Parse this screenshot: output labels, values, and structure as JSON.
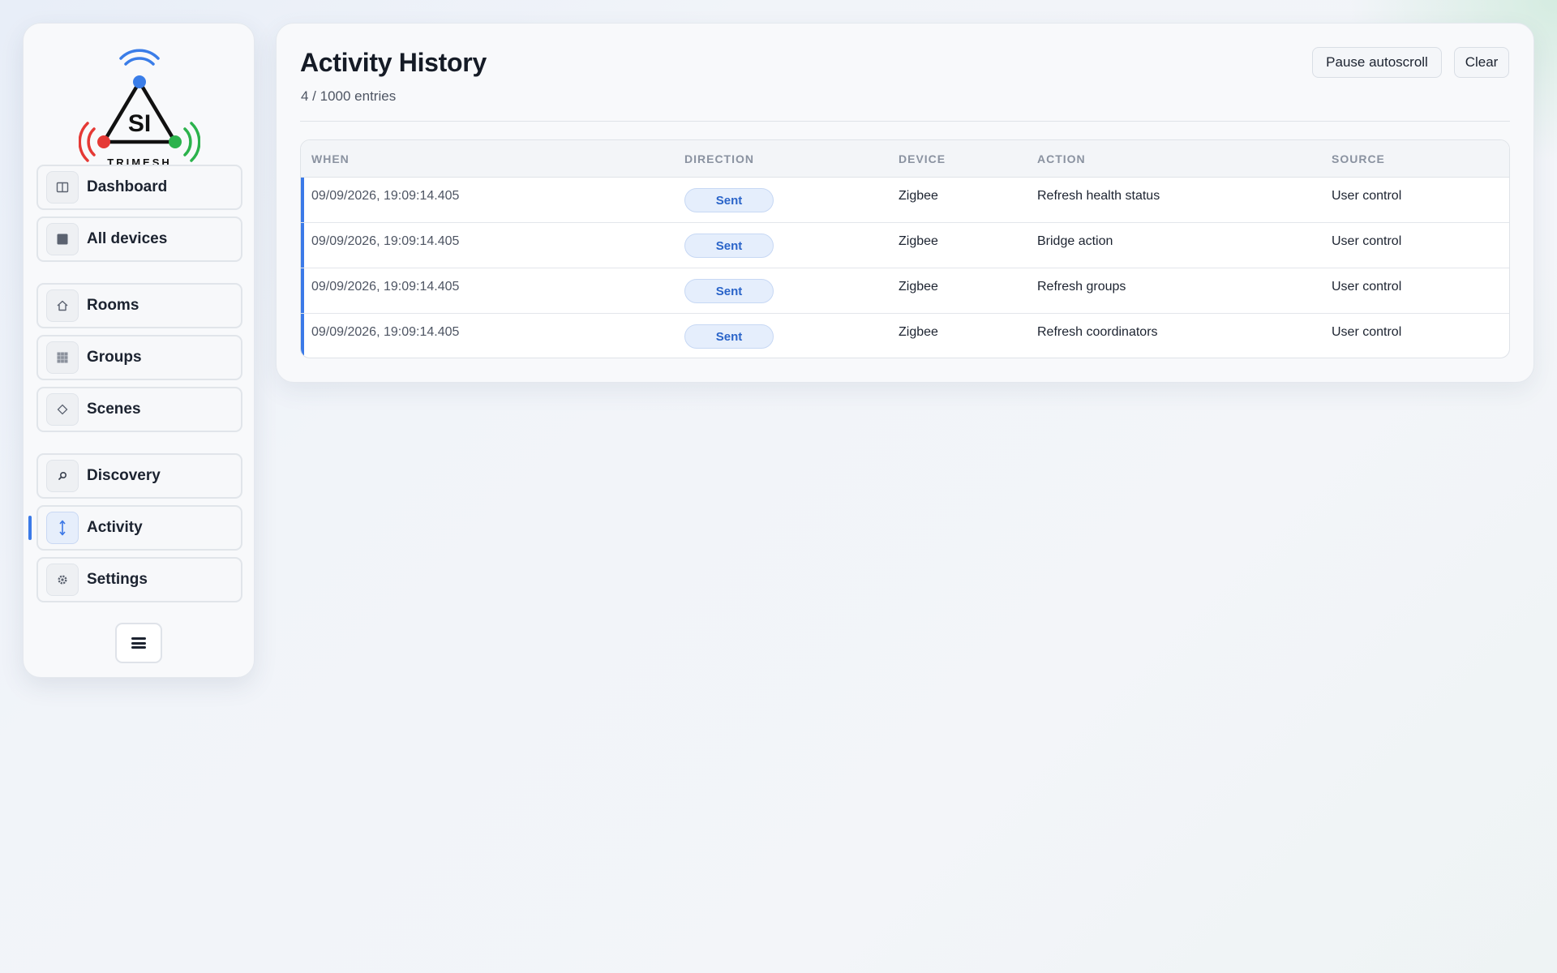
{
  "app": {
    "logo_text": "SI",
    "logo_subtext": "TRIMESH"
  },
  "sidebar": {
    "items": [
      {
        "label": "Dashboard",
        "icon": "dashboard-icon",
        "active": false
      },
      {
        "label": "All devices",
        "icon": "devices-icon",
        "active": false
      },
      {
        "label": "Rooms",
        "icon": "home-icon",
        "active": false
      },
      {
        "label": "Groups",
        "icon": "grid-icon",
        "active": false
      },
      {
        "label": "Scenes",
        "icon": "diamond-icon",
        "active": false
      },
      {
        "label": "Discovery",
        "icon": "search-icon",
        "active": false
      },
      {
        "label": "Activity",
        "icon": "updown-arrow-icon",
        "active": true
      },
      {
        "label": "Settings",
        "icon": "gear-icon",
        "active": false
      }
    ],
    "menu_button_icon": "hamburger-menu-icon"
  },
  "main": {
    "title": "Activity History",
    "subtitle": "4 / 1000 entries",
    "buttons": {
      "pause": "Pause autoscroll",
      "clear": "Clear"
    },
    "table": {
      "columns": [
        "WHEN",
        "DIRECTION",
        "DEVICE",
        "ACTION",
        "SOURCE"
      ],
      "rows": [
        {
          "when": "09/09/2026, 19:09:14.405",
          "direction": "Sent",
          "device": "Zigbee",
          "action": "Refresh health status",
          "source": "User control"
        },
        {
          "when": "09/09/2026, 19:09:14.405",
          "direction": "Sent",
          "device": "Zigbee",
          "action": "Bridge action",
          "source": "User control"
        },
        {
          "when": "09/09/2026, 19:09:14.405",
          "direction": "Sent",
          "device": "Zigbee",
          "action": "Refresh groups",
          "source": "User control"
        },
        {
          "when": "09/09/2026, 19:09:14.405",
          "direction": "Sent",
          "device": "Zigbee",
          "action": "Refresh coordinators",
          "source": "User control"
        }
      ]
    }
  },
  "colors": {
    "accent": "#3b7ae8",
    "pill_bg": "#e5eefc",
    "pill_text": "#2a64c9",
    "logo_blue": "#3a7de8",
    "logo_red": "#e53935",
    "logo_green": "#2bb24c"
  }
}
